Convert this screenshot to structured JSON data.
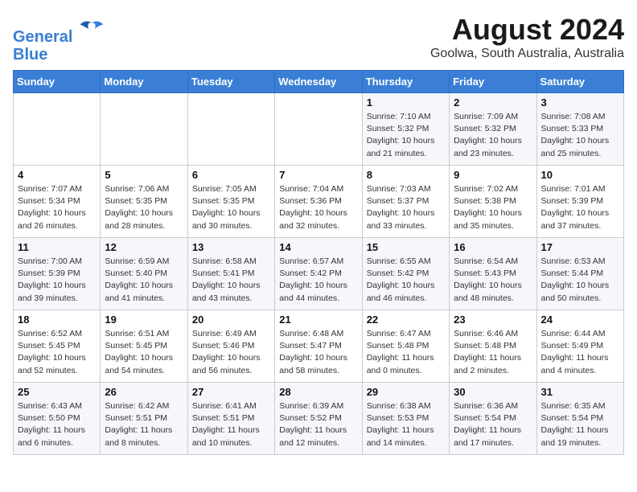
{
  "logo": {
    "line1": "General",
    "line2": "Blue"
  },
  "title": "August 2024",
  "subtitle": "Goolwa, South Australia, Australia",
  "weekdays": [
    "Sunday",
    "Monday",
    "Tuesday",
    "Wednesday",
    "Thursday",
    "Friday",
    "Saturday"
  ],
  "weeks": [
    [
      {
        "day": "",
        "info": ""
      },
      {
        "day": "",
        "info": ""
      },
      {
        "day": "",
        "info": ""
      },
      {
        "day": "",
        "info": ""
      },
      {
        "day": "1",
        "info": "Sunrise: 7:10 AM\nSunset: 5:32 PM\nDaylight: 10 hours\nand 21 minutes."
      },
      {
        "day": "2",
        "info": "Sunrise: 7:09 AM\nSunset: 5:32 PM\nDaylight: 10 hours\nand 23 minutes."
      },
      {
        "day": "3",
        "info": "Sunrise: 7:08 AM\nSunset: 5:33 PM\nDaylight: 10 hours\nand 25 minutes."
      }
    ],
    [
      {
        "day": "4",
        "info": "Sunrise: 7:07 AM\nSunset: 5:34 PM\nDaylight: 10 hours\nand 26 minutes."
      },
      {
        "day": "5",
        "info": "Sunrise: 7:06 AM\nSunset: 5:35 PM\nDaylight: 10 hours\nand 28 minutes."
      },
      {
        "day": "6",
        "info": "Sunrise: 7:05 AM\nSunset: 5:35 PM\nDaylight: 10 hours\nand 30 minutes."
      },
      {
        "day": "7",
        "info": "Sunrise: 7:04 AM\nSunset: 5:36 PM\nDaylight: 10 hours\nand 32 minutes."
      },
      {
        "day": "8",
        "info": "Sunrise: 7:03 AM\nSunset: 5:37 PM\nDaylight: 10 hours\nand 33 minutes."
      },
      {
        "day": "9",
        "info": "Sunrise: 7:02 AM\nSunset: 5:38 PM\nDaylight: 10 hours\nand 35 minutes."
      },
      {
        "day": "10",
        "info": "Sunrise: 7:01 AM\nSunset: 5:39 PM\nDaylight: 10 hours\nand 37 minutes."
      }
    ],
    [
      {
        "day": "11",
        "info": "Sunrise: 7:00 AM\nSunset: 5:39 PM\nDaylight: 10 hours\nand 39 minutes."
      },
      {
        "day": "12",
        "info": "Sunrise: 6:59 AM\nSunset: 5:40 PM\nDaylight: 10 hours\nand 41 minutes."
      },
      {
        "day": "13",
        "info": "Sunrise: 6:58 AM\nSunset: 5:41 PM\nDaylight: 10 hours\nand 43 minutes."
      },
      {
        "day": "14",
        "info": "Sunrise: 6:57 AM\nSunset: 5:42 PM\nDaylight: 10 hours\nand 44 minutes."
      },
      {
        "day": "15",
        "info": "Sunrise: 6:55 AM\nSunset: 5:42 PM\nDaylight: 10 hours\nand 46 minutes."
      },
      {
        "day": "16",
        "info": "Sunrise: 6:54 AM\nSunset: 5:43 PM\nDaylight: 10 hours\nand 48 minutes."
      },
      {
        "day": "17",
        "info": "Sunrise: 6:53 AM\nSunset: 5:44 PM\nDaylight: 10 hours\nand 50 minutes."
      }
    ],
    [
      {
        "day": "18",
        "info": "Sunrise: 6:52 AM\nSunset: 5:45 PM\nDaylight: 10 hours\nand 52 minutes."
      },
      {
        "day": "19",
        "info": "Sunrise: 6:51 AM\nSunset: 5:45 PM\nDaylight: 10 hours\nand 54 minutes."
      },
      {
        "day": "20",
        "info": "Sunrise: 6:49 AM\nSunset: 5:46 PM\nDaylight: 10 hours\nand 56 minutes."
      },
      {
        "day": "21",
        "info": "Sunrise: 6:48 AM\nSunset: 5:47 PM\nDaylight: 10 hours\nand 58 minutes."
      },
      {
        "day": "22",
        "info": "Sunrise: 6:47 AM\nSunset: 5:48 PM\nDaylight: 11 hours\nand 0 minutes."
      },
      {
        "day": "23",
        "info": "Sunrise: 6:46 AM\nSunset: 5:48 PM\nDaylight: 11 hours\nand 2 minutes."
      },
      {
        "day": "24",
        "info": "Sunrise: 6:44 AM\nSunset: 5:49 PM\nDaylight: 11 hours\nand 4 minutes."
      }
    ],
    [
      {
        "day": "25",
        "info": "Sunrise: 6:43 AM\nSunset: 5:50 PM\nDaylight: 11 hours\nand 6 minutes."
      },
      {
        "day": "26",
        "info": "Sunrise: 6:42 AM\nSunset: 5:51 PM\nDaylight: 11 hours\nand 8 minutes."
      },
      {
        "day": "27",
        "info": "Sunrise: 6:41 AM\nSunset: 5:51 PM\nDaylight: 11 hours\nand 10 minutes."
      },
      {
        "day": "28",
        "info": "Sunrise: 6:39 AM\nSunset: 5:52 PM\nDaylight: 11 hours\nand 12 minutes."
      },
      {
        "day": "29",
        "info": "Sunrise: 6:38 AM\nSunset: 5:53 PM\nDaylight: 11 hours\nand 14 minutes."
      },
      {
        "day": "30",
        "info": "Sunrise: 6:36 AM\nSunset: 5:54 PM\nDaylight: 11 hours\nand 17 minutes."
      },
      {
        "day": "31",
        "info": "Sunrise: 6:35 AM\nSunset: 5:54 PM\nDaylight: 11 hours\nand 19 minutes."
      }
    ]
  ]
}
